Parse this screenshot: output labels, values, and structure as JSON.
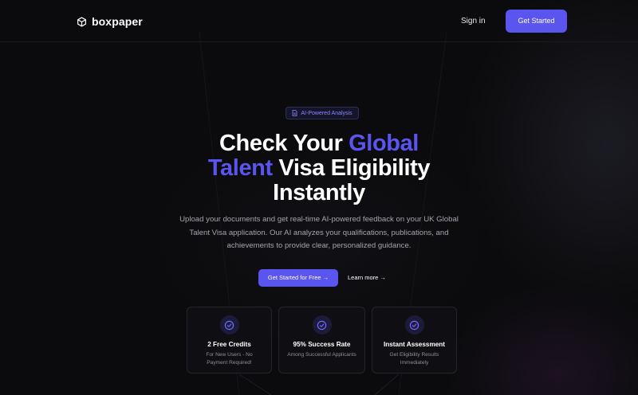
{
  "header": {
    "logo_text": "boxpaper",
    "logo_icon": "cube-icon",
    "signin_label": "Sign in",
    "get_started_label": "Get Started"
  },
  "hero": {
    "badge_icon": "document-icon",
    "badge_text": "AI-Powered Analysis",
    "title_part1": "Check Your ",
    "title_accent1": "Global",
    "title_accent2": "Talent",
    "title_part2": " Visa Eligibility",
    "title_part3": "Instantly",
    "description": "Upload your documents and get real-time AI-powered feedback on your UK Global Talent Visa application. Our AI analyzes your qualifications, publications, and achievements to provide clear, personalized guidance.",
    "cta_primary": "Get Started for Free →",
    "cta_secondary": "Learn more →"
  },
  "features": [
    {
      "icon": "check-circle-icon",
      "title": "2 Free Credits",
      "desc": "For New Users - No Payment Required!"
    },
    {
      "icon": "check-circle-icon",
      "title": "95% Success Rate",
      "desc": "Among Successful Applicants"
    },
    {
      "icon": "check-circle-icon",
      "title": "Instant Assessment",
      "desc": "Get Eligibility Results Immediately"
    }
  ],
  "colors": {
    "accent": "#5b55ef",
    "background": "#0b0b0d",
    "text_muted": "#a4a4ad"
  }
}
